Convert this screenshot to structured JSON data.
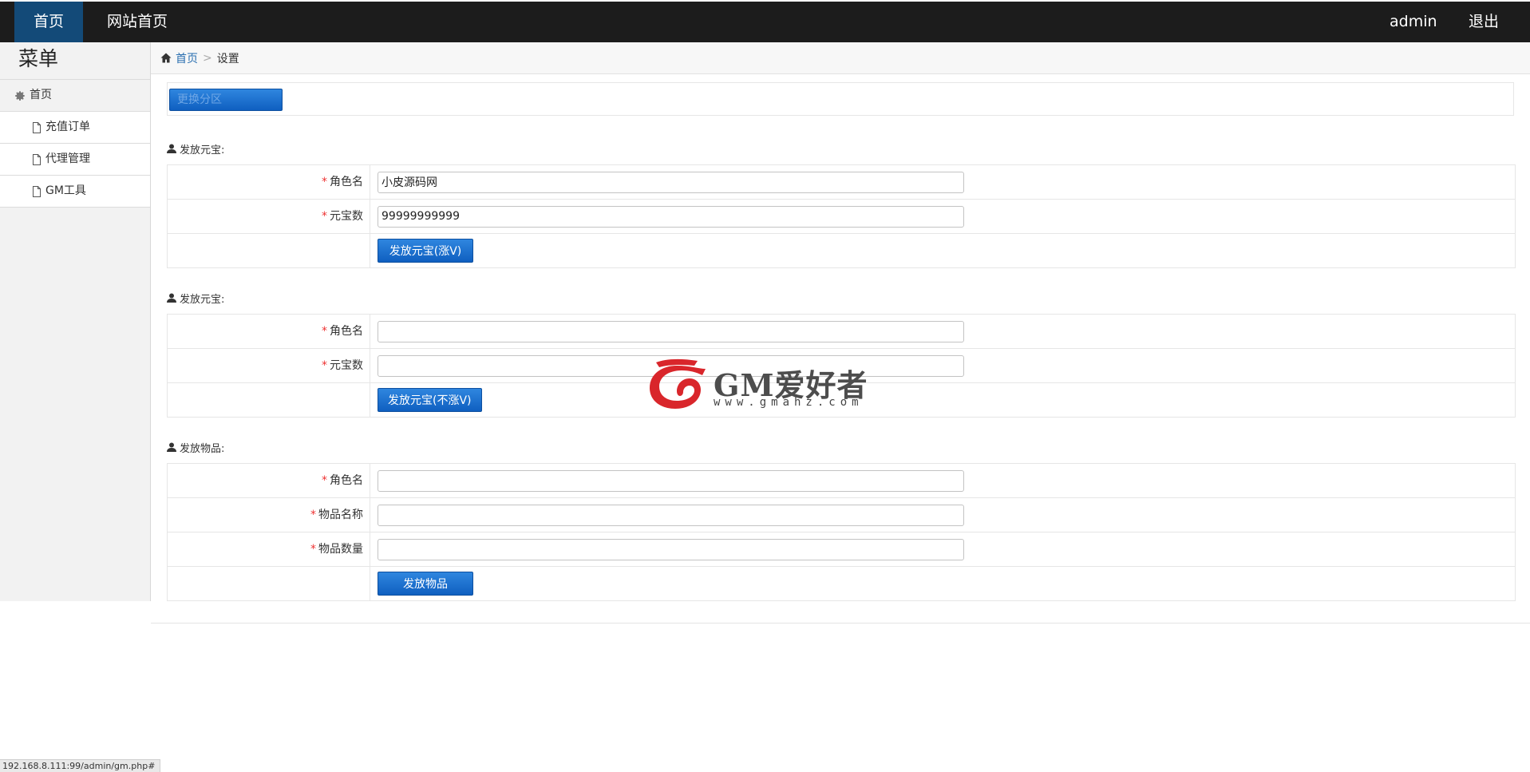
{
  "topnav": {
    "home": "首页",
    "site_home": "网站首页",
    "user": "admin",
    "logout": "退出"
  },
  "sidebar": {
    "title": "菜单",
    "home": "首页",
    "items": [
      {
        "label": "充值订单"
      },
      {
        "label": "代理管理"
      },
      {
        "label": "GM工具"
      }
    ]
  },
  "breadcrumb": {
    "home": "首页",
    "separator": ">",
    "current": "设置"
  },
  "toolbar": {
    "switch_label": "更换分区"
  },
  "sections": [
    {
      "title": "发放元宝:",
      "fields": [
        {
          "label": "角色名",
          "value": "小皮源码网"
        },
        {
          "label": "元宝数",
          "value": "99999999999"
        }
      ],
      "button": "发放元宝(涨V)"
    },
    {
      "title": "发放元宝:",
      "fields": [
        {
          "label": "角色名",
          "value": ""
        },
        {
          "label": "元宝数",
          "value": ""
        }
      ],
      "button": "发放元宝(不涨V)"
    },
    {
      "title": "发放物品:",
      "fields": [
        {
          "label": "角色名",
          "value": ""
        },
        {
          "label": "物品名称",
          "value": ""
        },
        {
          "label": "物品数量",
          "value": ""
        }
      ],
      "button": "发放物品"
    }
  ],
  "required_mark": "*",
  "watermark": {
    "text": "GM爱好者",
    "url": "www.gmahz.com"
  },
  "status_bar": {
    "url": "192.168.8.111:99/admin/gm.php#"
  },
  "colors": {
    "navbar": "#1c1c1c",
    "nav_active": "#134a78",
    "button": "#1a6fd0",
    "required": "#e33333"
  }
}
